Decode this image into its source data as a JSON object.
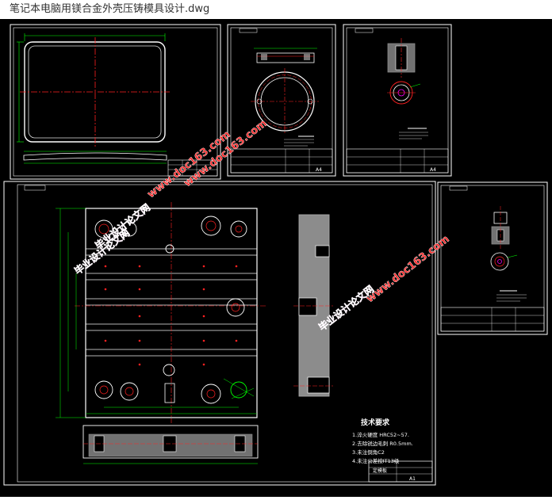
{
  "window": {
    "title": "笔记本电脑用镁合金外壳压铸模具设计.dwg"
  },
  "colors": {
    "frame": "#ffffff",
    "green": "#00ff00",
    "red": "#ff2020",
    "cyan": "#00ffff",
    "yellow": "#ffff00",
    "magenta": "#ff00ff",
    "hatch": "#e8e8e8",
    "watermark_red": "#ff2a2a",
    "watermark_magenta": "#ff33cc"
  },
  "sheets": {
    "sheet_size_label": "A4",
    "main_sheet_size_label": "A1"
  },
  "tech_requirements": {
    "heading": "技术要求",
    "items": [
      "1.淬火硬度 HRC52~57.",
      "2.去除锐边毛刺 R0.5mm.",
      "3.未注倒角C2",
      "4.未注公差按IT13级"
    ]
  },
  "main_sheet": {
    "part_label": "定模板"
  },
  "watermarks": [
    {
      "text": "www.doc163.com"
    },
    {
      "text": "毕业设计论文网"
    },
    {
      "text": "毕业设计论文网"
    },
    {
      "text": "www.doc163.com"
    },
    {
      "text": "毕业设计论文网"
    },
    {
      "text": "www.doc163.com"
    }
  ]
}
